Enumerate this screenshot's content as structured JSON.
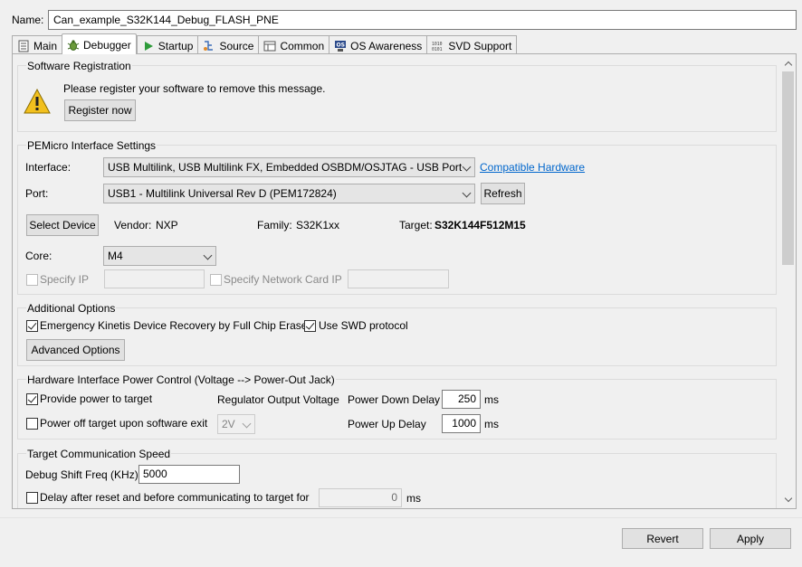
{
  "name": {
    "label": "Name:",
    "value": "Can_example_S32K144_Debug_FLASH_PNE"
  },
  "tabs": [
    {
      "label": "Main",
      "icon": "main-icon"
    },
    {
      "label": "Debugger",
      "icon": "debugger-icon"
    },
    {
      "label": "Startup",
      "icon": "startup-icon"
    },
    {
      "label": "Source",
      "icon": "source-icon"
    },
    {
      "label": "Common",
      "icon": "common-icon"
    },
    {
      "label": "OS Awareness",
      "icon": "os-awareness-icon"
    },
    {
      "label": "SVD Support",
      "icon": "svd-support-icon"
    }
  ],
  "software_registration": {
    "title": "Software Registration",
    "message": "Please register your software to remove this message.",
    "button": "Register now",
    "icon": "warning-icon"
  },
  "pemicro": {
    "title": "PEMicro Interface Settings",
    "interface_label": "Interface:",
    "interface_value": "USB Multilink, USB Multilink FX, Embedded OSBDM/OSJTAG - USB Port",
    "compatible_hardware": "Compatible Hardware",
    "port_label": "Port:",
    "port_value": "USB1 - Multilink Universal Rev D (PEM172824)",
    "refresh": "Refresh",
    "select_device": "Select Device",
    "vendor_label": "Vendor:",
    "vendor_value": "NXP",
    "family_label": "Family:",
    "family_value": "S32K1xx",
    "target_label": "Target:",
    "target_value": "S32K144F512M15",
    "core_label": "Core:",
    "core_value": "M4",
    "specify_ip": "Specify IP",
    "specify_network_card_ip": "Specify Network Card IP"
  },
  "additional_options": {
    "title": "Additional Options",
    "emergency": "Emergency Kinetis Device Recovery by Full Chip Erase",
    "swd": "Use SWD protocol",
    "advanced": "Advanced Options"
  },
  "power_control": {
    "title": "Hardware Interface Power Control (Voltage --> Power-Out Jack)",
    "provide_power": "Provide power to target",
    "regulator_label": "Regulator Output Voltage",
    "power_down_label": "Power Down Delay",
    "power_down_value": "250",
    "ms1": "ms",
    "power_off": "Power off target upon software exit",
    "voltage_value": "2V",
    "power_up_label": "Power Up Delay",
    "power_up_value": "1000",
    "ms2": "ms"
  },
  "comm_speed": {
    "title": "Target Communication Speed",
    "freq_label": "Debug Shift Freq (KHz)",
    "freq_value": "5000",
    "delay_label": "Delay after reset and before communicating to target for",
    "delay_value": "0",
    "ms": "ms"
  },
  "buttons": {
    "revert": "Revert",
    "apply": "Apply"
  }
}
